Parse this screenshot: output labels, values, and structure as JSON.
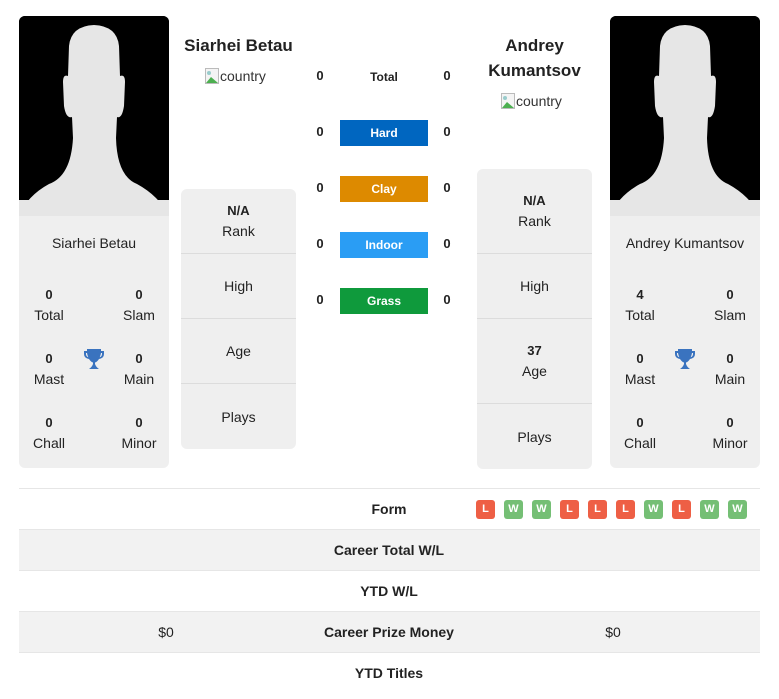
{
  "players": [
    {
      "name": "Siarhei Betau",
      "country_alt": "country",
      "titles": {
        "total": {
          "value": "0",
          "label": "Total"
        },
        "slam": {
          "value": "0",
          "label": "Slam"
        },
        "mast": {
          "value": "0",
          "label": "Mast"
        },
        "main": {
          "value": "0",
          "label": "Main"
        },
        "chall": {
          "value": "0",
          "label": "Chall"
        },
        "minor": {
          "value": "0",
          "label": "Minor"
        }
      },
      "info": {
        "rank": {
          "value": "N/A",
          "label": "Rank"
        },
        "high": {
          "value": "",
          "label": "High"
        },
        "age": {
          "value": "",
          "label": "Age"
        },
        "plays": {
          "value": "",
          "label": "Plays"
        }
      }
    },
    {
      "name": "Andrey Kumantsov",
      "name_line1": "Andrey",
      "name_line2": "Kumantsov",
      "country_alt": "country",
      "titles": {
        "total": {
          "value": "4",
          "label": "Total"
        },
        "slam": {
          "value": "0",
          "label": "Slam"
        },
        "mast": {
          "value": "0",
          "label": "Mast"
        },
        "main": {
          "value": "0",
          "label": "Main"
        },
        "chall": {
          "value": "0",
          "label": "Chall"
        },
        "minor": {
          "value": "0",
          "label": "Minor"
        }
      },
      "info": {
        "rank": {
          "value": "N/A",
          "label": "Rank"
        },
        "high": {
          "value": "",
          "label": "High"
        },
        "age": {
          "value": "37",
          "label": "Age"
        },
        "plays": {
          "value": "",
          "label": "Plays"
        }
      }
    }
  ],
  "h2h": [
    {
      "label": "Total",
      "left": "0",
      "right": "0",
      "color": ""
    },
    {
      "label": "Hard",
      "left": "0",
      "right": "0",
      "color": "#0066c0"
    },
    {
      "label": "Clay",
      "left": "0",
      "right": "0",
      "color": "#dd8a00"
    },
    {
      "label": "Indoor",
      "left": "0",
      "right": "0",
      "color": "#2a9df4"
    },
    {
      "label": "Grass",
      "left": "0",
      "right": "0",
      "color": "#0f9a3c"
    }
  ],
  "colors": {
    "win": "#75bf75",
    "loss": "#ee5f45",
    "trophy": "#3a73bf"
  },
  "stats": {
    "form_label": "Form",
    "form": [
      "L",
      "W",
      "W",
      "L",
      "L",
      "L",
      "W",
      "L",
      "W",
      "W"
    ],
    "rows": [
      {
        "label": "Career Total W/L",
        "left": "",
        "right": ""
      },
      {
        "label": "YTD W/L",
        "left": "",
        "right": ""
      },
      {
        "label": "Career Prize Money",
        "left": "$0",
        "right": "$0"
      },
      {
        "label": "YTD Titles",
        "left": "",
        "right": ""
      }
    ]
  }
}
